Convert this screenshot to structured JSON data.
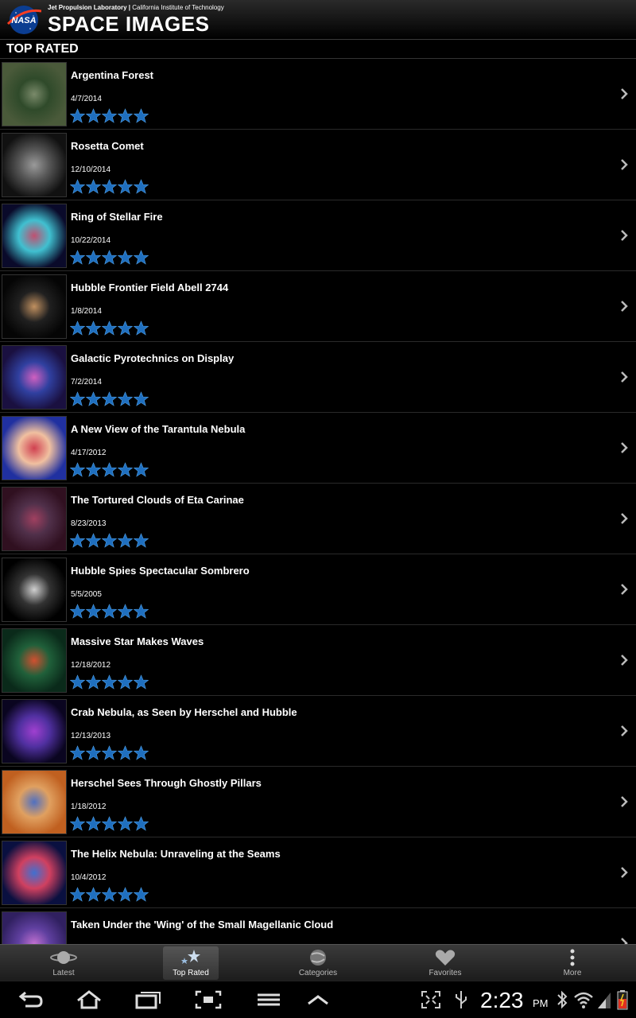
{
  "header": {
    "org_bold": "Jet Propulsion Laboratory |",
    "org_rest": " California Institute of Technology",
    "logo_text": "NASA",
    "title": "SPACE IMAGES"
  },
  "section": {
    "title": "TOP RATED"
  },
  "items": [
    {
      "title": "Argentina Forest",
      "date": "4/7/2014",
      "rating": 5,
      "thumb": [
        "#4a5a3a",
        "#7a8a6a",
        "#2f4a2a"
      ]
    },
    {
      "title": "Rosetta Comet",
      "date": "12/10/2014",
      "rating": 5,
      "thumb": [
        "#111",
        "#9a9a9a",
        "#555"
      ]
    },
    {
      "title": "Ring of Stellar Fire",
      "date": "10/22/2014",
      "rating": 5,
      "thumb": [
        "#0a0a2a",
        "#c05070",
        "#40c0d0"
      ]
    },
    {
      "title": "Hubble Frontier Field Abell 2744",
      "date": "1/8/2014",
      "rating": 5,
      "thumb": [
        "#050505",
        "#c09060",
        "#202020"
      ]
    },
    {
      "title": "Galactic Pyrotechnics on Display",
      "date": "7/2/2014",
      "rating": 5,
      "thumb": [
        "#1a1040",
        "#d060c0",
        "#3040a0"
      ]
    },
    {
      "title": "A New View of the Tarantula Nebula",
      "date": "4/17/2012",
      "rating": 5,
      "thumb": [
        "#2030a0",
        "#d04050",
        "#f0c0a0"
      ]
    },
    {
      "title": "The Tortured Clouds of Eta Carinae",
      "date": "8/23/2013",
      "rating": 5,
      "thumb": [
        "#301020",
        "#a04060",
        "#50304a"
      ]
    },
    {
      "title": "Hubble Spies Spectacular Sombrero",
      "date": "5/5/2005",
      "rating": 5,
      "thumb": [
        "#000",
        "#d0d0d0",
        "#333"
      ]
    },
    {
      "title": "Massive Star Makes Waves",
      "date": "12/18/2012",
      "rating": 5,
      "thumb": [
        "#0a2a1a",
        "#d05030",
        "#20603a"
      ]
    },
    {
      "title": "Crab Nebula, as Seen by Herschel and Hubble",
      "date": "12/13/2013",
      "rating": 5,
      "thumb": [
        "#0a0520",
        "#a040d0",
        "#5030a0"
      ]
    },
    {
      "title": "Herschel Sees Through Ghostly Pillars",
      "date": "1/18/2012",
      "rating": 5,
      "thumb": [
        "#c06020",
        "#5070c0",
        "#e0a060"
      ]
    },
    {
      "title": "The Helix Nebula: Unraveling at the Seams",
      "date": "10/4/2012",
      "rating": 5,
      "thumb": [
        "#0a1040",
        "#4070d0",
        "#d04060"
      ]
    },
    {
      "title": "Taken Under the 'Wing' of the Small Magellanic Cloud",
      "date": "",
      "rating": 0,
      "thumb": [
        "#302060",
        "#c070d0",
        "#6040a0"
      ]
    }
  ],
  "tabs": [
    {
      "label": "Latest",
      "icon": "planet-icon",
      "active": false
    },
    {
      "label": "Top Rated",
      "icon": "stars-icon",
      "active": true
    },
    {
      "label": "Categories",
      "icon": "galaxy-icon",
      "active": false
    },
    {
      "label": "Favorites",
      "icon": "heart-icon",
      "active": false
    },
    {
      "label": "More",
      "icon": "more-icon",
      "active": false
    }
  ],
  "system": {
    "time": "2:23",
    "ampm": "PM"
  },
  "colors": {
    "star": "#1f6fbf",
    "star_highlight": "#4f9fe6",
    "background": "#000000"
  }
}
